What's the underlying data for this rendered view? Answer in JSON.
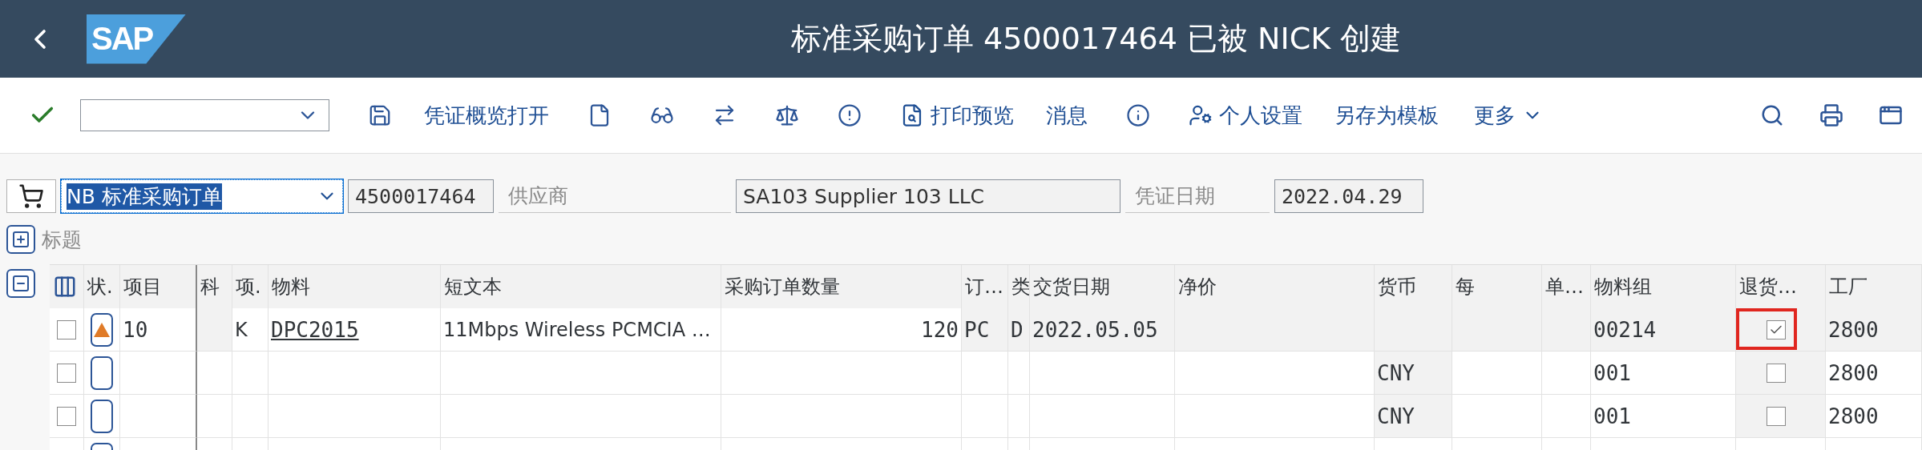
{
  "header": {
    "logo": "SAP",
    "title": "标准采购订单 4500017464 已被 NICK 创建"
  },
  "toolbar": {
    "buttons": [
      "凭证概览打开",
      "打印预览",
      "消息",
      "个人设置",
      "另存为模板",
      "更多"
    ]
  },
  "form": {
    "order_type": "NB 标准采购订单",
    "order_number": "4500017464",
    "supplier_label": "供应商",
    "supplier": "SA103 Supplier 103 LLC",
    "date_label": "凭证日期",
    "date": "2022.04.29",
    "section_label": "标题"
  },
  "table": {
    "columns": [
      "状.",
      "项目",
      "科",
      "项.",
      "物料",
      "短文本",
      "采购订单数量",
      "订…",
      "类",
      "交货日期",
      "净价",
      "货币",
      "每",
      "单…",
      "物料组",
      "退货…",
      "工厂"
    ],
    "rows": [
      {
        "selected": false,
        "warning": true,
        "cells": [
          {
            "kind": "text",
            "text": "10",
            "readonly": false
          },
          {
            "kind": "text",
            "readonly": true
          },
          {
            "kind": "text",
            "text": "K",
            "readonly": false
          },
          {
            "kind": "link",
            "text": "DPC2015",
            "readonly": false
          },
          {
            "kind": "text",
            "text": "11Mbps Wireless PCMCIA …",
            "readonly": false
          },
          {
            "kind": "number",
            "text": "120",
            "readonly": false
          },
          {
            "kind": "text",
            "text": "PC",
            "readonly": true
          },
          {
            "kind": "text",
            "text": "D",
            "readonly": true
          },
          {
            "kind": "text",
            "text": "2022.05.05",
            "readonly": true
          },
          {
            "kind": "text",
            "readonly": true
          },
          {
            "kind": "text",
            "readonly": true
          },
          {
            "kind": "text",
            "readonly": true
          },
          {
            "kind": "text",
            "readonly": true
          },
          {
            "kind": "text",
            "text": "00214",
            "readonly": true
          },
          {
            "kind": "check",
            "checked": true,
            "flagged": true,
            "readonly": true
          },
          {
            "kind": "text",
            "text": "2800",
            "readonly": true
          }
        ]
      },
      {
        "selected": false,
        "warning": false,
        "cells": [
          {
            "kind": "text",
            "readonly": false
          },
          {
            "kind": "text",
            "readonly": false
          },
          {
            "kind": "text",
            "readonly": false
          },
          {
            "kind": "text",
            "readonly": false
          },
          {
            "kind": "text",
            "readonly": false
          },
          {
            "kind": "number",
            "readonly": false
          },
          {
            "kind": "text",
            "readonly": false
          },
          {
            "kind": "text",
            "readonly": false
          },
          {
            "kind": "text",
            "readonly": false
          },
          {
            "kind": "text",
            "readonly": false
          },
          {
            "kind": "text",
            "text": "CNY",
            "readonly": true
          },
          {
            "kind": "text",
            "readonly": false
          },
          {
            "kind": "text",
            "readonly": false
          },
          {
            "kind": "text",
            "text": "001",
            "readonly": false
          },
          {
            "kind": "check",
            "checked": false,
            "flagged": false,
            "readonly": true
          },
          {
            "kind": "text",
            "text": "2800",
            "readonly": false
          }
        ]
      },
      {
        "selected": false,
        "warning": false,
        "cells": [
          {
            "kind": "text",
            "readonly": false
          },
          {
            "kind": "text",
            "readonly": false
          },
          {
            "kind": "text",
            "readonly": false
          },
          {
            "kind": "text",
            "readonly": false
          },
          {
            "kind": "text",
            "readonly": false
          },
          {
            "kind": "number",
            "readonly": false
          },
          {
            "kind": "text",
            "readonly": false
          },
          {
            "kind": "text",
            "readonly": false
          },
          {
            "kind": "text",
            "readonly": false
          },
          {
            "kind": "text",
            "readonly": false
          },
          {
            "kind": "text",
            "text": "CNY",
            "readonly": true
          },
          {
            "kind": "text",
            "readonly": false
          },
          {
            "kind": "text",
            "readonly": false
          },
          {
            "kind": "text",
            "text": "001",
            "readonly": false
          },
          {
            "kind": "check",
            "checked": false,
            "flagged": false,
            "readonly": true
          },
          {
            "kind": "text",
            "text": "2800",
            "readonly": false
          }
        ]
      },
      {}
    ]
  }
}
